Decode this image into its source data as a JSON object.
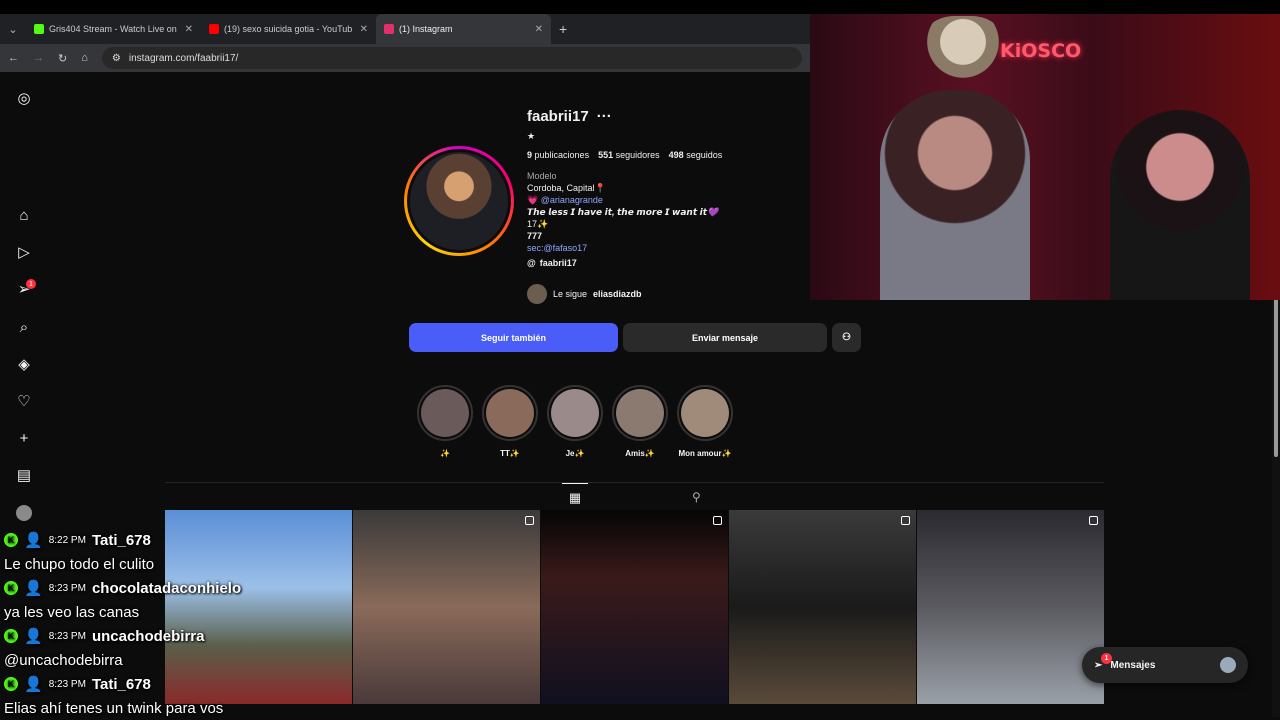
{
  "browser": {
    "tabs": [
      {
        "title": "Gris404 Stream - Watch Live on",
        "favicon_color": "#53fc18",
        "active": false
      },
      {
        "title": "(19) sexo suicida gotia - YouTub",
        "favicon_color": "#ff0000",
        "active": false
      },
      {
        "title": "(1) Instagram",
        "favicon_color": "#e1306c",
        "active": true
      }
    ],
    "url": "instagram.com/faabrii17/"
  },
  "profile": {
    "username": "faabrii17",
    "star": "★",
    "posts_count": "9",
    "posts_label": "publicaciones",
    "followers_count": "551",
    "followers_label": "seguidores",
    "following_count": "498",
    "following_label": "seguidos",
    "category": "Modelo",
    "bio_lines": [
      "Cordoba, Capital📍",
      "💗 @arianagrande",
      "𝙏𝙝𝙚 𝙡𝙚𝙨𝙨 𝙄 𝙝𝙖𝙫𝙚 𝙞𝙩, 𝙩𝙝𝙚 𝙢𝙤𝙧𝙚 𝙄 𝙬𝙖𝙣𝙩 𝙞𝙩💜",
      "17✨",
      "777",
      "sec:@fafaso17"
    ],
    "threads": "faabrii17",
    "followed_by_prefix": "Le sigue",
    "followed_by_user": "eliasdiazdb",
    "follow_button": "Seguir también",
    "message_button": "Enviar mensaje"
  },
  "highlights": [
    {
      "label": "✨",
      "color": "#6a5a5a"
    },
    {
      "label": "TT✨",
      "color": "#8a6a5a"
    },
    {
      "label": "Je✨",
      "color": "#9a8a8a"
    },
    {
      "label": "Amis✨",
      "color": "#8a7a70"
    },
    {
      "label": "Mon amour✨",
      "color": "#a08a7a"
    }
  ],
  "posts": [
    {
      "name": "post-1",
      "bg": "linear-gradient(180deg,#5a8ed6 0%,#9cc0e8 40%,#5a5f4a 70%,#8a2a2a 100%)"
    },
    {
      "name": "post-2",
      "bg": "linear-gradient(180deg,#3a3a3a 0%,#8a6a5a 50%,#4a3a3a 100%)"
    },
    {
      "name": "post-3",
      "bg": "linear-gradient(180deg,#050505 0%,#3a1a1a 35%,#101020 100%)"
    },
    {
      "name": "post-4",
      "bg": "linear-gradient(180deg,#3a3a3a 0%,#1a1a1a 50%,#5a4a3a 100%)"
    },
    {
      "name": "post-5",
      "bg": "linear-gradient(180deg,#2a2a30 0%,#5a5a60 50%,#9aa0a8 100%)"
    }
  ],
  "messages_widget": {
    "label": "Mensajes",
    "badge": "1"
  },
  "sidebar_badges": {
    "notifications": "1"
  },
  "webcam": {
    "sign": "KiOSCO"
  },
  "chat": [
    {
      "time": "8:22 PM",
      "user": "Tati_678",
      "message": "Le chupo todo el culito"
    },
    {
      "time": "8:23 PM",
      "user": "chocolatadaconhielo",
      "message": "ya les veo las canas"
    },
    {
      "time": "8:23 PM",
      "user": "uncachodebirra",
      "message": "@uncachodebirra"
    },
    {
      "time": "8:23 PM",
      "user": "Tati_678",
      "message": "Elias ahí tenes un twink para vos"
    }
  ],
  "colors": {
    "accent": "#4a5df9",
    "kick": "#53fc18",
    "badge": "#ff3040"
  }
}
